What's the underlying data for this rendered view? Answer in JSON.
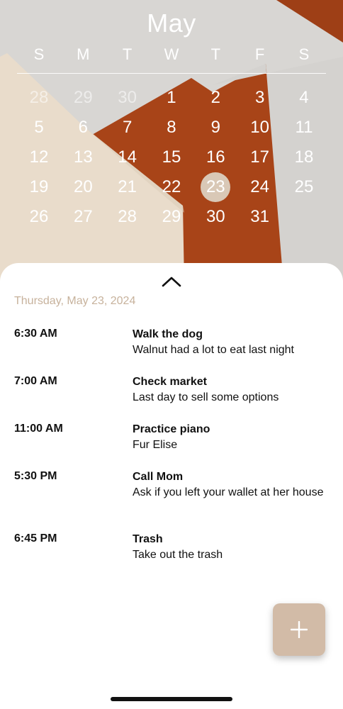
{
  "calendar": {
    "month": "May",
    "weekdays": [
      "S",
      "M",
      "T",
      "W",
      "T",
      "F",
      "S"
    ],
    "weeks": [
      [
        "28",
        "29",
        "30",
        "1",
        "2",
        "3",
        "4"
      ],
      [
        "5",
        "6",
        "7",
        "8",
        "9",
        "10",
        "11"
      ],
      [
        "12",
        "13",
        "14",
        "15",
        "16",
        "17",
        "18"
      ],
      [
        "19",
        "20",
        "21",
        "22",
        "23",
        "24",
        "25"
      ],
      [
        "26",
        "27",
        "28",
        "29",
        "30",
        "31",
        ""
      ]
    ],
    "selected": "23",
    "dim_previous_month": [
      "28",
      "29",
      "30"
    ]
  },
  "agenda": {
    "date": "Thursday, May 23, 2024",
    "events": [
      {
        "time": "6:30 AM",
        "title": "Walk the dog",
        "desc": "Walnut had a lot to eat last night"
      },
      {
        "time": "7:00 AM",
        "title": "Check market",
        "desc": "Last day to sell some options"
      },
      {
        "time": "11:00 AM",
        "title": "Practice piano",
        "desc": "Fur Elise"
      },
      {
        "time": "5:30 PM",
        "title": "Call Mom",
        "desc": "Ask if you left your wallet at her house"
      },
      {
        "time": "6:45 PM",
        "title": "Trash",
        "desc": "Take out the trash"
      }
    ]
  },
  "icons": {
    "collapse": "chevron-up-icon",
    "add": "plus-icon"
  },
  "colors": {
    "accent": "#d2bba7",
    "date_text": "#c7b29c",
    "selected_day": "#d9c8b6",
    "rust": "#a84418"
  }
}
